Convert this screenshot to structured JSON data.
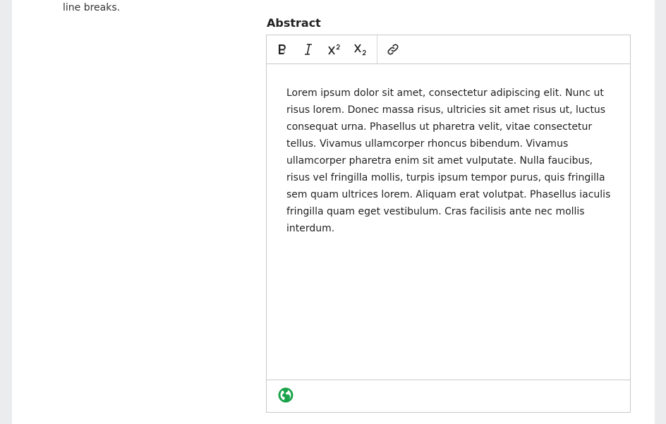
{
  "help_text": "line breaks.",
  "field": {
    "label": "Abstract"
  },
  "toolbar": {
    "buttons": [
      {
        "name": "bold",
        "icon": "bold-icon"
      },
      {
        "name": "italic",
        "icon": "italic-icon"
      },
      {
        "name": "superscript",
        "icon": "superscript-icon"
      },
      {
        "name": "subscript",
        "icon": "subscript-icon"
      },
      {
        "name": "link",
        "icon": "link-icon"
      }
    ]
  },
  "editor": {
    "content": "Lorem ipsum dolor sit amet, consectetur adipiscing elit. Nunc ut risus lorem. Donec massa risus, ultricies sit amet risus ut, luctus consequat urna. Phasellus ut pharetra velit, vitae consectetur tellus. Vivamus ullamcorper rhoncus bibendum. Vivamus ullamcorper pharetra enim sit amet vulputate. Nulla faucibus, risus vel fringilla mollis, turpis ipsum tempor purus, quis fringilla sem quam ultrices lorem. Aliquam erat volutpat. Phasellus iaculis fringilla quam eget vestibulum. Cras facilisis ante nec mollis interdum."
  },
  "statusbar": {
    "icon": "globe-icon",
    "icon_color": "#1aa34a"
  }
}
